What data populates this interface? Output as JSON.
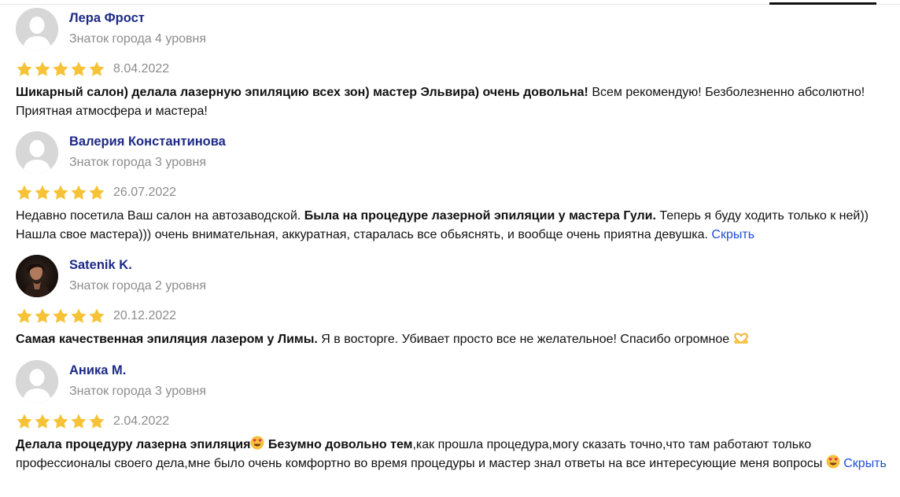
{
  "colors": {
    "name": "#1d2a86",
    "meta": "#8c8c8c",
    "star": "#f6c338",
    "link": "#1f4fd6"
  },
  "reviews": [
    {
      "author": "Лера Фрост",
      "level": "Знаток города 4 уровня",
      "rating": 5,
      "date": "8.04.2022",
      "bold": "Шикарный салон) делала лазерную эпиляцию всех зон) мастер Эльвира) очень довольна!",
      "text": " Всем рекомендую! Безболезненно абсолютно! Приятная атмосфера и мастера!"
    },
    {
      "author": "Валерия Константинова",
      "level": "Знаток города 3 уровня",
      "rating": 5,
      "date": "26.07.2022",
      "lead": "Недавно посетила Ваш салон на автозаводской. ",
      "bold": "Была на процедуре лазерной эпиляции у мастера Гули.",
      "text": " Теперь я буду ходить только к ней)) Нашла свое мастера))) очень внимательная, аккуратная, старалась все обьяснять, и вообще очень приятна девушка. ",
      "toggle": "Скрыть"
    },
    {
      "author": "Satenik K.",
      "level": "Знаток города 2 уровня",
      "rating": 5,
      "date": "20.12.2022",
      "bold": "Самая качественная эпиляция лазером у Лимы.",
      "text": " Я в восторге. Убивает просто все не желательное! Спасибо огромное ",
      "emoji": "heart-hands-emoji"
    },
    {
      "author": "Аника М.",
      "level": "Знаток города 3 уровня",
      "rating": 5,
      "date": "2.04.2022",
      "bold": "Делала процедуру лазерна эпиляция",
      "bold2": " Безумно довольно тем",
      "text": ",как прошла процедура,могу сказать точно,что там работают только профессионалы своего дела,мне было очень комфортно во время процедуры и мастер знал ответы на все интересующие меня вопросы ",
      "emoji": "heart-eyes-emoji",
      "toggle": "Скрыть"
    }
  ]
}
